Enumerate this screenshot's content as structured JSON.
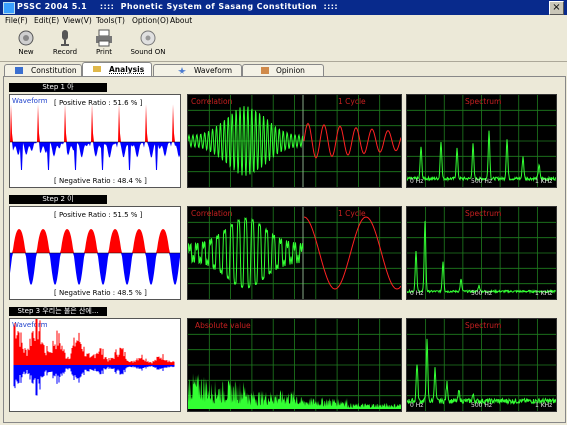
{
  "window": {
    "title": "PSSC 2004 5.1    ::::  Phonetic System of Sasang Constitution  ::::",
    "close_label": "×"
  },
  "menu": [
    {
      "label": "File(F)"
    },
    {
      "label": "Edit(E)"
    },
    {
      "label": "View(V)"
    },
    {
      "label": "Tools(T)"
    },
    {
      "label": "Option(O)"
    },
    {
      "label": "About"
    }
  ],
  "toolbar": [
    {
      "label": "New",
      "icon": "new-document-icon"
    },
    {
      "label": "Record",
      "icon": "microphone-icon"
    },
    {
      "label": "Print",
      "icon": "printer-icon"
    },
    {
      "label": "Sound ON",
      "icon": "speaker-icon"
    }
  ],
  "tabs": [
    {
      "label": "Constitution",
      "icon": "book-icon",
      "active": false
    },
    {
      "label": "Analysis",
      "icon": "folder-icon",
      "active": true
    },
    {
      "label": "Waveform",
      "icon": "star-icon",
      "active": false
    },
    {
      "label": "Opinion",
      "icon": "pencil-icon",
      "active": false
    }
  ],
  "colors": {
    "scope_bg": "#000000",
    "grid": "#1f7d1f",
    "trace_green": "#33ff33",
    "trace_red": "#ff2222",
    "wave_red": "#ff0000",
    "wave_blue": "#0000ff",
    "label_red": "#c62020"
  },
  "steps": [
    {
      "label": "Step 1 아",
      "waveform": {
        "title": "Waveform",
        "positive_ratio": "[ Positive Ratio :  51.6 % ]",
        "negative_ratio": "[ Negative Ratio :  48.4 % ]"
      },
      "correlation": {
        "left_label": "Correlation",
        "right_label": "1 Cycle"
      },
      "spectrum": {
        "label": "Spectrum",
        "axis": [
          "0 Hz",
          "500 Hz",
          "1 KHz"
        ]
      }
    },
    {
      "label": "Step 2 이",
      "waveform": {
        "title": "Waveform",
        "positive_ratio": "[ Positive Ratio :  51.5 % ]",
        "negative_ratio": "[ Negative Ratio :  48.5 % ]"
      },
      "correlation": {
        "left_label": "Correlation",
        "right_label": "1 Cycle"
      },
      "spectrum": {
        "label": "Spectrum",
        "axis": [
          "0 Hz",
          "500 Hz",
          "1 KHz"
        ]
      }
    },
    {
      "label": "Step 3 우리는 불은 산에...",
      "waveform": {
        "title": "Waveform"
      },
      "absolute": {
        "label": "Absolute value"
      },
      "spectrum": {
        "label": "Spectrum",
        "axis": [
          "0 Hz",
          "500 Hz",
          "1 KHz"
        ]
      }
    }
  ]
}
